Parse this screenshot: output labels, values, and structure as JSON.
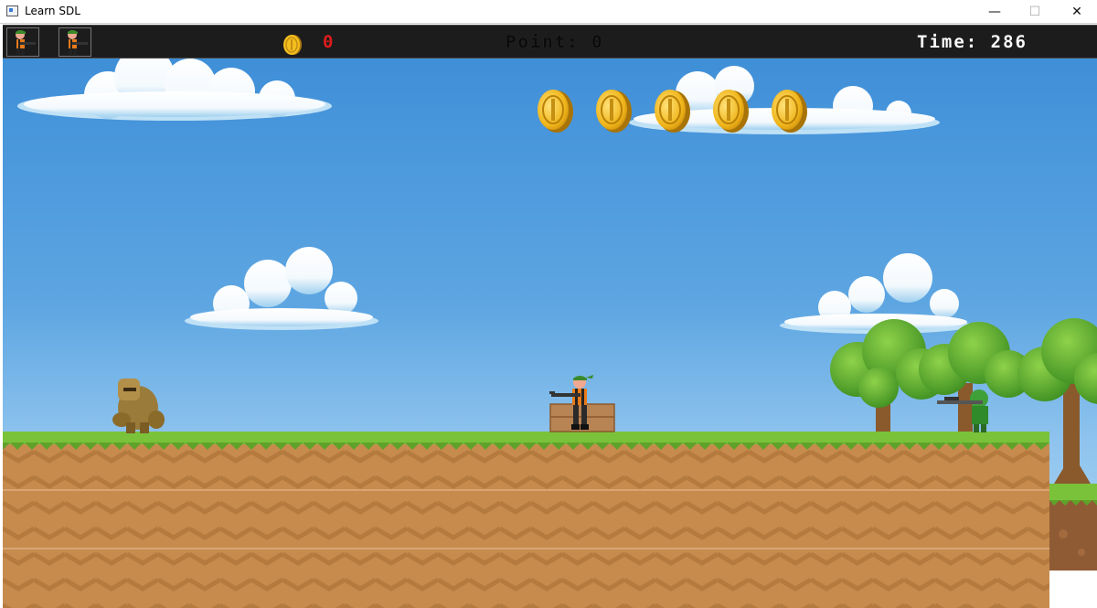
{
  "window": {
    "title": "Learn SDL",
    "minimize_glyph": "—",
    "maximize_glyph": "☐",
    "close_glyph": "✕"
  },
  "hud": {
    "lives": 2,
    "coin_count": "0",
    "points_label": "Point:",
    "points_value": "0",
    "time_label": "Time:",
    "time_value": "286"
  },
  "icons": {
    "life": "soldier-life-icon",
    "coin": "coin-icon"
  },
  "colors": {
    "sky_top": "#3f8fd8",
    "sky_bottom": "#b6dcf5",
    "grass": "#7ac23a",
    "dirt": "#c58a4c",
    "coin": "#f2bf1f",
    "hud_bg": "#1c1c1c",
    "coin_count": "#e01b1b"
  },
  "scene": {
    "floating_coins": 5,
    "enemies": [
      "rock-golem",
      "sniper-soldier"
    ],
    "player": "commando"
  }
}
